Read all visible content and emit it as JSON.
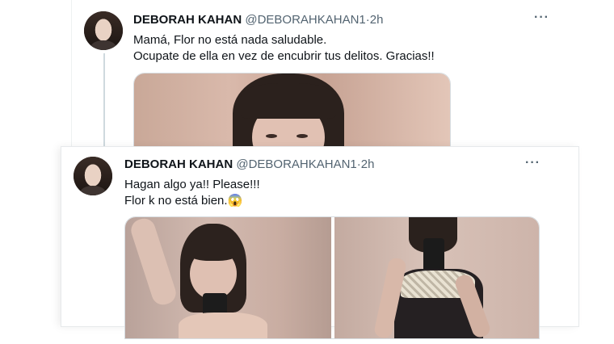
{
  "tweets": [
    {
      "author_name": "DEBORAH KAHAN",
      "author_handle": "@DEBORAHKAHAN1",
      "separator": "·",
      "time": "2h",
      "more_label": "···",
      "lines": [
        "Mamá, Flor no está nada saludable.",
        "Ocupate de ella en vez de encubrir tus delitos. Gracias!!"
      ]
    },
    {
      "author_name": "DEBORAH KAHAN",
      "author_handle": "@DEBORAHKAHAN1",
      "separator": "·",
      "time": "2h",
      "more_label": "···",
      "lines": [
        "Hagan algo ya!! Please!!!",
        "Flor k no está bien."
      ],
      "emoji": "😱"
    }
  ],
  "colors": {
    "text": "#0f1419",
    "secondary": "#536471",
    "thread_line": "#cfd9de"
  },
  "icons": [
    "avatar-photo",
    "more-options-icon",
    "scream-emoji"
  ]
}
